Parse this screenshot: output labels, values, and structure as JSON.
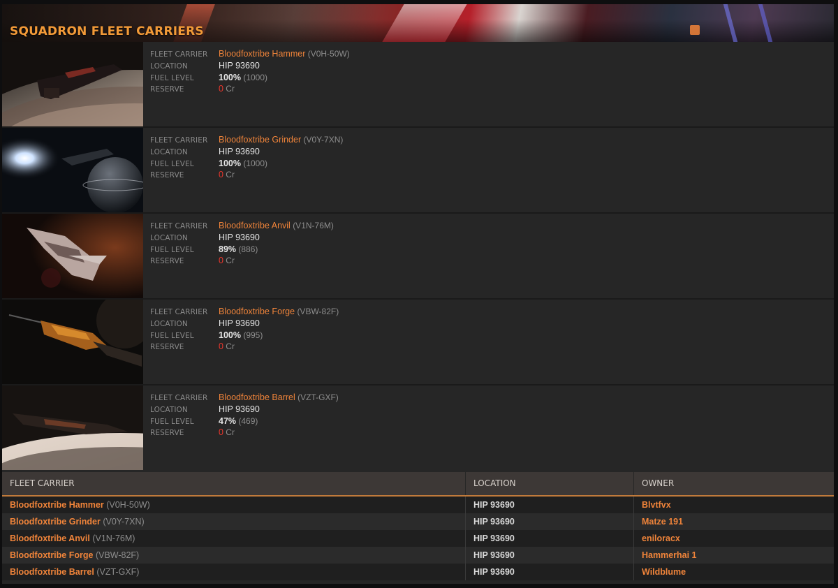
{
  "header": {
    "title": "SQUADRON FLEET CARRIERS"
  },
  "labels": {
    "fleet_carrier": "FLEET CARRIER",
    "location": "LOCATION",
    "fuel_level": "FUEL LEVEL",
    "reserve": "RESERVE",
    "currency": "Cr"
  },
  "carriers": [
    {
      "name": "Bloodfoxtribe Hammer",
      "callsign": "(V0H-50W)",
      "location": "HIP 93690",
      "fuel_pct": "100%",
      "fuel_amount": "(1000)",
      "reserve": "0",
      "owner": "Blvtfvx"
    },
    {
      "name": "Bloodfoxtribe Grinder",
      "callsign": "(V0Y-7XN)",
      "location": "HIP 93690",
      "fuel_pct": "100%",
      "fuel_amount": "(1000)",
      "reserve": "0",
      "owner": "Matze 191"
    },
    {
      "name": "Bloodfoxtribe Anvil",
      "callsign": "(V1N-76M)",
      "location": "HIP 93690",
      "fuel_pct": "89%",
      "fuel_amount": "(886)",
      "reserve": "0",
      "owner": "eniloracx"
    },
    {
      "name": "Bloodfoxtribe Forge",
      "callsign": "(VBW-82F)",
      "location": "HIP 93690",
      "fuel_pct": "100%",
      "fuel_amount": "(995)",
      "reserve": "0",
      "owner": "Hammerhai 1"
    },
    {
      "name": "Bloodfoxtribe Barrel",
      "callsign": "(VZT-GXF)",
      "location": "HIP 93690",
      "fuel_pct": "47%",
      "fuel_amount": "(469)",
      "reserve": "0",
      "owner": "Wildblume"
    }
  ],
  "table": {
    "headers": {
      "fleet_carrier": "FLEET CARRIER",
      "location": "LOCATION",
      "owner": "OWNER"
    }
  },
  "colors": {
    "accent": "#f0843a",
    "reserve": "#e8362c",
    "header_rule": "#c07a3b"
  }
}
